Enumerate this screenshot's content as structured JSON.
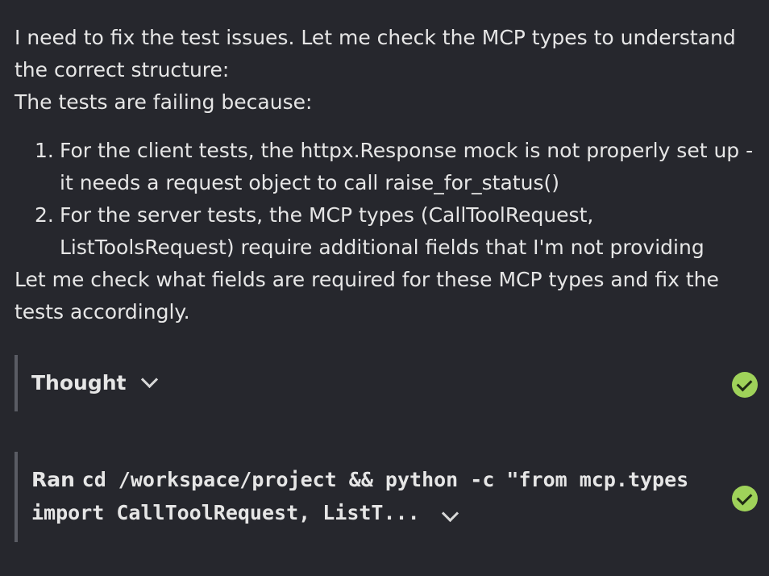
{
  "message": {
    "intro_line": "I need to fix the test issues. Let me check the MCP types to understand the correct structure:",
    "reason_line": "The tests are failing because:",
    "steps": [
      {
        "num": "1.",
        "text": "For the client tests, the httpx.Response mock is not properly set up - it needs a request object to call raise_for_status()"
      },
      {
        "num": "2.",
        "text": "For the server tests, the MCP types (CallToolRequest, ListToolsRequest) require additional fields that I'm not providing"
      }
    ],
    "closing_line": "Let me check what fields are required for these MCP types and fix the tests accordingly."
  },
  "thought_block": {
    "label": "Thought",
    "toggle_icon": "chevron-down-icon",
    "status_icon": "check-circle-icon",
    "status_color": "#9fd25a"
  },
  "ran_block": {
    "prefix": "Ran",
    "command": "cd /workspace/project && python -c \"from mcp.types import CallToolRequest, ListT...",
    "toggle_icon": "chevron-down-icon",
    "status_icon": "check-circle-icon",
    "status_color": "#9fd25a"
  }
}
